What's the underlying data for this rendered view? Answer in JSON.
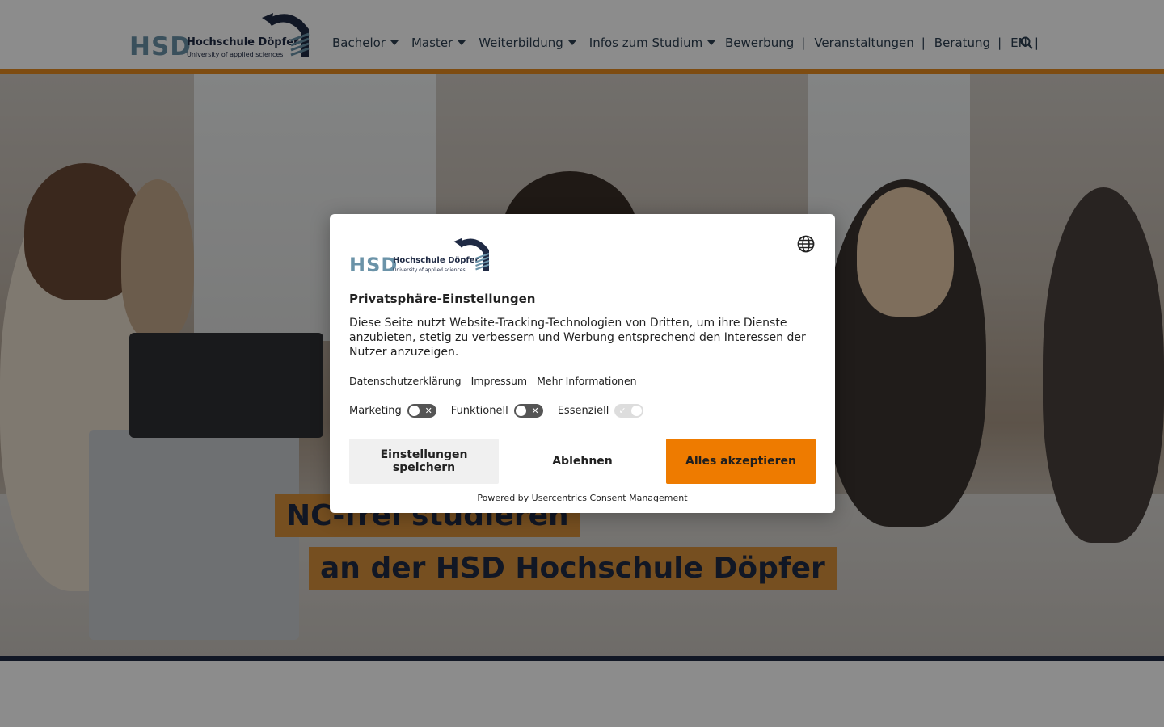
{
  "header": {
    "logo": {
      "abbr": "HSD",
      "name": "Hochschule Döpfer",
      "tagline": "University of applied sciences"
    },
    "nav": [
      {
        "label": "Bachelor"
      },
      {
        "label": "Master"
      },
      {
        "label": "Weiterbildung"
      },
      {
        "label": "Infos zum Studium"
      }
    ],
    "utility": [
      {
        "label": "Bewerbung"
      },
      {
        "label": "Veranstaltungen"
      },
      {
        "label": "Beratung"
      },
      {
        "label": "EN"
      }
    ],
    "search_icon": "search-icon",
    "accent_color": "#e58a1f"
  },
  "hero": {
    "title_line1": "NC-frei studieren",
    "title_line2": "an der HSD Hochschule Döpfer",
    "highlight_color": "#d8913b"
  },
  "consent": {
    "logo": {
      "abbr": "HSD",
      "name": "Hochschule Döpfer",
      "tagline": "University of applied sciences"
    },
    "language_icon": "globe-icon",
    "title": "Privatsphäre-Einstellungen",
    "text": "Diese Seite nutzt Website-Tracking-Technologien von Dritten, um ihre Dienste anzubieten, stetig zu verbessern und Werbung entsprechend den Interessen der Nutzer anzuzeigen.",
    "links": [
      "Datenschutzerklärung",
      "Impressum",
      "Mehr Informationen"
    ],
    "toggles": [
      {
        "label": "Marketing",
        "state": "off"
      },
      {
        "label": "Funktionell",
        "state": "off"
      },
      {
        "label": "Essenziell",
        "state": "on-disabled"
      }
    ],
    "buttons": {
      "save": "Einstellungen speichern",
      "deny": "Ablehnen",
      "accept": "Alles akzeptieren"
    },
    "accept_color": "#ee7b00",
    "powered_by": "Powered by Usercentrics Consent Management"
  }
}
